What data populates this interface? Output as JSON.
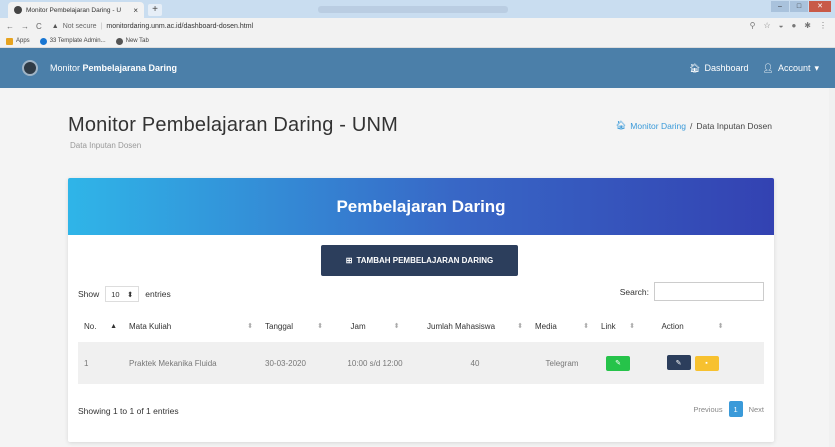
{
  "browser": {
    "tab_title": "Monitor Pembelajaran Daring - U",
    "tab_close": "×",
    "newtab": "+",
    "not_secure": "Not secure",
    "url": "monitordaring.unm.ac.id/dashboard-dosen.html",
    "bookmarks": [
      {
        "label": "Apps",
        "color": "#e7a31f"
      },
      {
        "label": "33 Template Admin...",
        "color": "#1976d2"
      },
      {
        "label": "New Tab",
        "color": "#555555"
      }
    ]
  },
  "navbar": {
    "brand_prefix": "Monitor ",
    "brand_bold": "Pembelajarana Daring",
    "dashboard": "Dashboard",
    "account": "Account",
    "bg": "#4b7fa9"
  },
  "header": {
    "title": "Monitor Pembelajaran Daring - UNM",
    "subtitle": "Data Inputan Dosen",
    "breadcrumb_home": "Monitor Daring",
    "breadcrumb_sep": "/",
    "breadcrumb_current": "Data Inputan Dosen"
  },
  "card": {
    "title": "Pembelajaran Daring",
    "add_button": "TAMBAH PEMBELAJARAN DARING",
    "show_label": "Show",
    "entries_value": "10",
    "entries_label": "entries",
    "search_label": "Search:",
    "search_value": "",
    "columns": [
      "No.",
      "Mata Kuliah",
      "Tanggal",
      "Jam",
      "Jumlah Mahasiswa",
      "Media",
      "Link",
      "Action"
    ],
    "rows": [
      {
        "no": "1",
        "mata_kuliah": "Praktek Mekanika Fluida",
        "tanggal": "30-03-2020",
        "jam": "10:00 s/d 12:00",
        "jumlah": "40",
        "media": "Telegram"
      }
    ],
    "info": "Showing 1 to 1 of 1 entries",
    "prev": "Previous",
    "page": "1",
    "next": "Next"
  }
}
